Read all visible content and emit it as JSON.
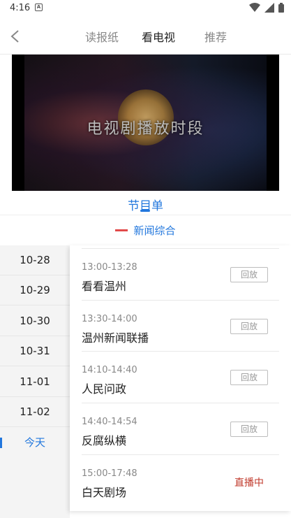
{
  "status_bar": {
    "time": "4:16",
    "notification_icon": "A"
  },
  "top_nav": {
    "tabs": [
      {
        "label": "读报纸",
        "active": false
      },
      {
        "label": "看电视",
        "active": true
      },
      {
        "label": "推荐",
        "active": false
      }
    ]
  },
  "video": {
    "overlay_title": "电视剧播放时段"
  },
  "schedule": {
    "title": "节目单",
    "channel": "新闻综合",
    "accent": "#2277dd"
  },
  "dates": [
    {
      "label": "10-28",
      "active": false
    },
    {
      "label": "10-29",
      "active": false
    },
    {
      "label": "10-30",
      "active": false
    },
    {
      "label": "10-31",
      "active": false
    },
    {
      "label": "11-01",
      "active": false
    },
    {
      "label": "11-02",
      "active": false
    },
    {
      "label": "今天",
      "active": true
    }
  ],
  "programs": [
    {
      "time": "13:00-13:28",
      "name": "看看温州",
      "action": "回放"
    },
    {
      "time": "13:30-14:00",
      "name": "温州新闻联播",
      "action": "回放"
    },
    {
      "time": "14:10-14:40",
      "name": "人民问政",
      "action": "回放"
    },
    {
      "time": "14:40-14:54",
      "name": "反腐纵横",
      "action": "回放"
    },
    {
      "time": "15:00-17:48",
      "name": "白天剧场",
      "action": "直播中"
    }
  ],
  "colors": {
    "live": "#c0392b",
    "accent": "#2277dd"
  }
}
